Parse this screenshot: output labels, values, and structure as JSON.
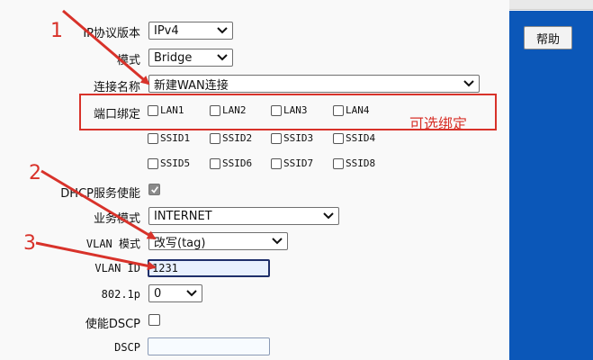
{
  "help": {
    "label": "帮助"
  },
  "form": {
    "ip_version": {
      "label": "IP协议版本",
      "value": "IPv4"
    },
    "mode": {
      "label": "模式",
      "value": "Bridge"
    },
    "connection_name": {
      "label": "连接名称",
      "value": "新建WAN连接"
    },
    "port_binding": {
      "label": "端口绑定",
      "ports": [
        {
          "name": "LAN1",
          "checked": false
        },
        {
          "name": "LAN2",
          "checked": false
        },
        {
          "name": "LAN3",
          "checked": false
        },
        {
          "name": "LAN4",
          "checked": false
        },
        {
          "name": "SSID1",
          "checked": false
        },
        {
          "name": "SSID2",
          "checked": false
        },
        {
          "name": "SSID3",
          "checked": false
        },
        {
          "name": "SSID4",
          "checked": false
        },
        {
          "name": "SSID5",
          "checked": false
        },
        {
          "name": "SSID6",
          "checked": false
        },
        {
          "name": "SSID7",
          "checked": false
        },
        {
          "name": "SSID8",
          "checked": false
        }
      ]
    },
    "dhcp": {
      "label": "DHCP服务使能",
      "checked": true
    },
    "service_mode": {
      "label": "业务模式",
      "value": "INTERNET"
    },
    "vlan_mode": {
      "label": "VLAN 模式",
      "value": "改写(tag)"
    },
    "vlan_id": {
      "label": "VLAN ID",
      "value": "1231"
    },
    "priority": {
      "label": "802.1p",
      "value": "0"
    },
    "dscp_enable": {
      "label": "使能DSCP",
      "checked": false
    },
    "dscp": {
      "label": "DSCP",
      "value": ""
    }
  },
  "annotations": {
    "optional_text": "可选绑定",
    "step1": "1",
    "step2": "2",
    "step3": "3",
    "color": "#d8322a"
  },
  "colors": {
    "sidebar": "#0b57b8",
    "accent_red": "#d8322a"
  }
}
